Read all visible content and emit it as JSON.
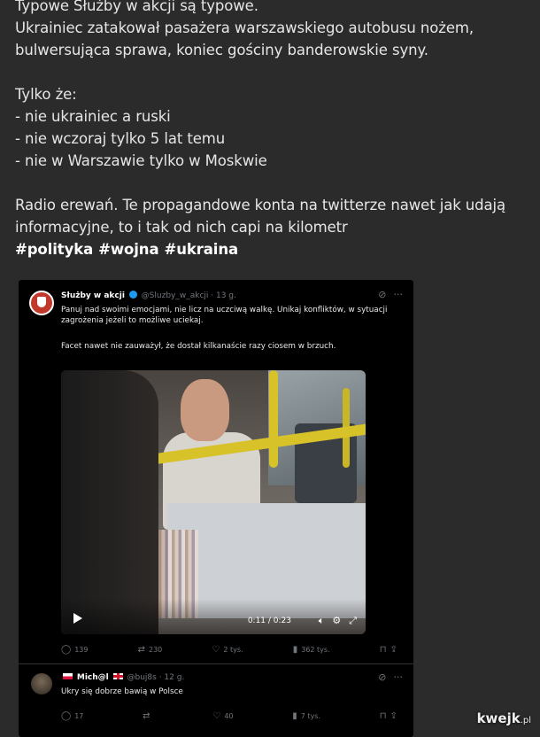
{
  "post": {
    "lines": [
      "Typowe Służby w akcji są typowe.",
      "Ukrainiec zatakował pasażera warszawskiego autobusu nożem,",
      "bulwersująca sprawa, koniec gościny banderowskie syny.",
      "",
      "Tylko że:",
      "- nie ukrainiec a ruski",
      "- nie wczoraj tylko 5 lat temu",
      "- nie w Warszawie tylko w Moskwie",
      "",
      "Radio erewań. Te propagandowe konta na twitterze nawet jak udają",
      "informacyjne, to i tak od nich capi na kilometr"
    ],
    "tags": [
      "#polityka",
      "#wojna",
      "#ukraina"
    ]
  },
  "tweet": {
    "author_name": "Służby w akcji",
    "handle_time": "@Sluzby_w_akcji · 13 g.",
    "body": "Panuj nad swoimi emocjami, nie licz na uczciwą walkę. Unikaj konfliktów, w sytuacji zagrożenia jeżeli to możliwe uciekaj.",
    "quote": "Facet nawet nie zauważył, że dostał kilkanaście razy ciosem w brzuch.",
    "video": {
      "time": "0:11 / 0:23",
      "progress": 0.48
    },
    "actions": {
      "replies": "139",
      "retweets": "230",
      "likes": "2 tys.",
      "views": "362 tys."
    }
  },
  "reply": {
    "author_name": "Mich@l",
    "handle_time": "@buj8s · 12 g.",
    "body": "Ukry się dobrze bawią w Polsce",
    "actions": {
      "replies": "17",
      "retweets": "",
      "likes": "40",
      "views": "7 tys."
    }
  },
  "watermark": {
    "brand": "kwejk",
    "tld": ".pl"
  },
  "colors": {
    "page_bg": "#2b2b2b",
    "tweet_bg": "#000000",
    "verified": "#1d9bf0",
    "rail": "#d7c22a"
  }
}
